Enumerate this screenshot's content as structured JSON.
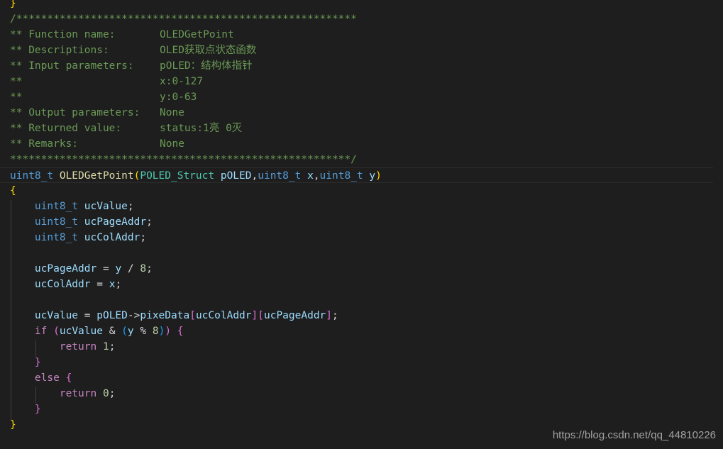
{
  "code": {
    "top_brace": "}",
    "comment_top": "/*******************************************************",
    "comment_rows": [
      {
        "label": "** Function name:",
        "value": "OLEDGetPoint"
      },
      {
        "label": "** Descriptions:",
        "value": "OLED获取点状态函数"
      },
      {
        "label": "** Input parameters:",
        "value": "pOLED：结构体指针"
      },
      {
        "label": "**",
        "value": "x:0-127"
      },
      {
        "label": "**",
        "value": "y:0-63"
      },
      {
        "label": "** Output parameters:",
        "value": "None"
      },
      {
        "label": "** Returned value:",
        "value": "status:1亮 0灭"
      },
      {
        "label": "** Remarks:",
        "value": "None"
      }
    ],
    "comment_bottom": "*******************************************************/",
    "signature": {
      "ret_type": "uint8_t",
      "name": "OLEDGetPoint",
      "open": "(",
      "p1_type": "POLED_Struct",
      "p1_name": "pOLED",
      "comma": ",",
      "p2_type": "uint8_t",
      "p2_name": "x",
      "p3_type": "uint8_t",
      "p3_name": "y",
      "close": ")"
    },
    "open_brace": "{",
    "decl1": {
      "type": "uint8_t",
      "name": "ucValue",
      "end": ";"
    },
    "decl2": {
      "type": "uint8_t",
      "name": "ucPageAddr",
      "end": ";"
    },
    "decl3": {
      "type": "uint8_t",
      "name": "ucColAddr",
      "end": ";"
    },
    "assign1": {
      "lhs": "ucPageAddr",
      "eq": " = ",
      "a": "y",
      "op": " / ",
      "n": "8",
      "end": ";"
    },
    "assign2": {
      "lhs": "ucColAddr",
      "eq": " = ",
      "a": "x",
      "end": ";"
    },
    "assign3": {
      "lhs": "ucValue",
      "eq": " = ",
      "obj": "pOLED",
      "arrow": "->",
      "member": "pixeData",
      "lb1": "[",
      "idx1": "ucColAddr",
      "rb1": "]",
      "lb2": "[",
      "idx2": "ucPageAddr",
      "rb2": "]",
      "end": ";"
    },
    "if_line": {
      "kw": "if",
      "sp": " ",
      "p1": "(",
      "v": "ucValue",
      "amp": " & ",
      "p2": "(",
      "y": "y",
      "mod": " % ",
      "n": "8",
      "p2c": ")",
      "p1c": ")",
      "sp2": " ",
      "brace": "{"
    },
    "return1": {
      "kw": "return",
      "sp": " ",
      "n": "1",
      "end": ";"
    },
    "close_if": "}",
    "else_line": {
      "kw": "else",
      "sp": " ",
      "brace": "{"
    },
    "return0": {
      "kw": "return",
      "sp": " ",
      "n": "0",
      "end": ";"
    },
    "close_else": "}",
    "close_fn": "}"
  },
  "watermark": "https://blog.csdn.net/qq_44810226"
}
